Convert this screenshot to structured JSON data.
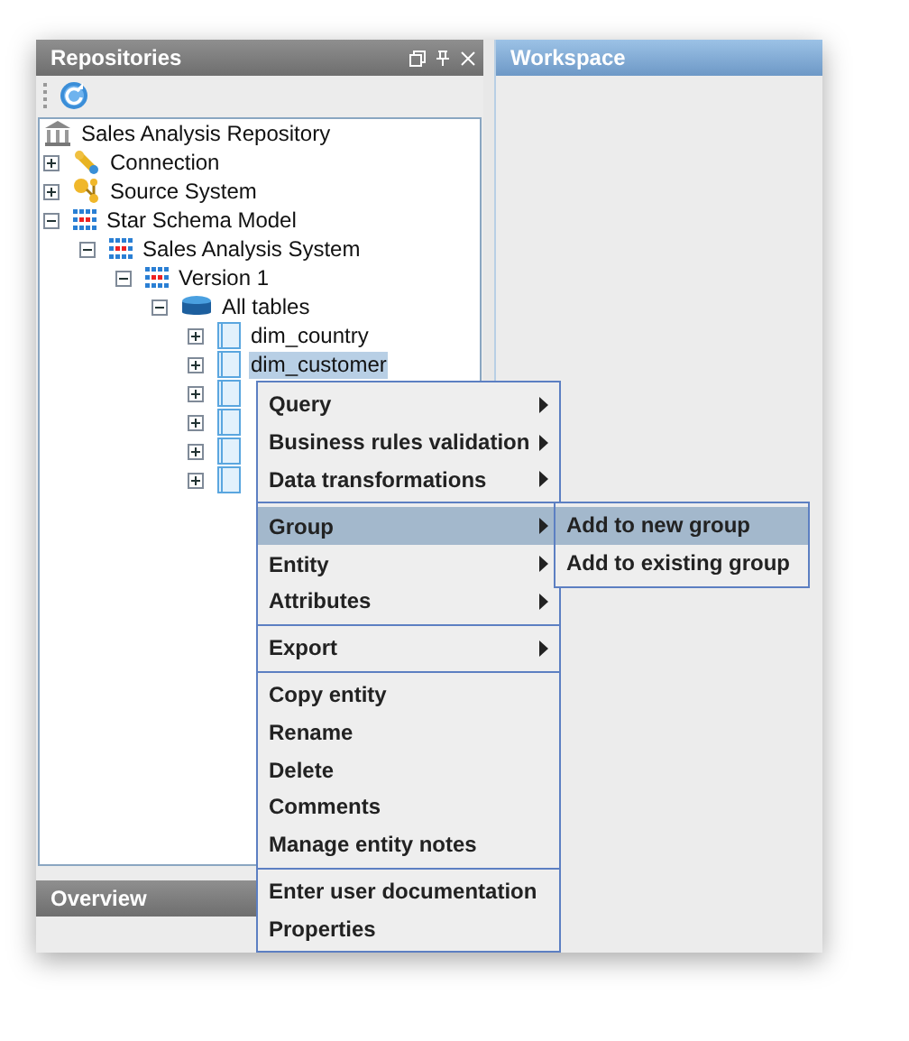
{
  "panels": {
    "repositories": {
      "title": "Repositories"
    },
    "workspace": {
      "title": "Workspace"
    },
    "overview": {
      "title": "Overview"
    }
  },
  "tree": [
    {
      "label": "Sales Analysis Repository",
      "kind": "repository",
      "selected": false,
      "children": [
        {
          "label": "Connection",
          "kind": "connection",
          "expanded": false,
          "selected": false
        },
        {
          "label": "Source System",
          "kind": "source",
          "expanded": false,
          "selected": false
        },
        {
          "label": "Star Schema Model",
          "kind": "model",
          "expanded": true,
          "selected": false,
          "children": [
            {
              "label": "Sales Analysis System",
              "kind": "model",
              "expanded": true,
              "selected": false,
              "children": [
                {
                  "label": "Version 1",
                  "kind": "model",
                  "expanded": true,
                  "selected": false,
                  "children": [
                    {
                      "label": "All tables",
                      "kind": "tables",
                      "expanded": true,
                      "selected": false,
                      "children": [
                        {
                          "label": "dim_country",
                          "kind": "table",
                          "expanded": false,
                          "selected": false
                        },
                        {
                          "label": "dim_customer",
                          "kind": "table",
                          "expanded": false,
                          "selected": true
                        },
                        {
                          "kind": "table",
                          "expanded": false,
                          "selected": false
                        },
                        {
                          "kind": "table",
                          "expanded": false,
                          "selected": false
                        },
                        {
                          "kind": "table",
                          "expanded": false,
                          "selected": false
                        },
                        {
                          "kind": "table",
                          "expanded": false,
                          "selected": false
                        }
                      ]
                    }
                  ]
                }
              ]
            }
          ]
        }
      ]
    }
  ],
  "context_menu": {
    "sections": [
      [
        {
          "label": "Query",
          "submenu": true,
          "selected": false
        },
        {
          "label": "Business rules validation",
          "submenu": true,
          "selected": false
        },
        {
          "label": "Data transformations",
          "submenu": true,
          "selected": false
        }
      ],
      [
        {
          "label": "Group",
          "submenu": true,
          "selected": true
        },
        {
          "label": "Entity",
          "submenu": true,
          "selected": false
        },
        {
          "label": "Attributes",
          "submenu": true,
          "selected": false
        }
      ],
      [
        {
          "label": "Export",
          "submenu": true,
          "selected": false
        }
      ],
      [
        {
          "label": "Copy entity",
          "submenu": false,
          "selected": false
        },
        {
          "label": "Rename",
          "submenu": false,
          "selected": false
        },
        {
          "label": "Delete",
          "submenu": false,
          "selected": false
        },
        {
          "label": "Comments",
          "submenu": false,
          "selected": false
        },
        {
          "label": "Manage entity notes",
          "submenu": false,
          "selected": false
        }
      ],
      [
        {
          "label": "Enter user documentation",
          "submenu": false,
          "selected": false
        },
        {
          "label": "Properties",
          "submenu": false,
          "selected": false
        }
      ]
    ]
  },
  "submenu": {
    "items": [
      {
        "label": "Add to new group",
        "selected": true
      },
      {
        "label": "Add to existing group",
        "selected": false
      }
    ]
  }
}
